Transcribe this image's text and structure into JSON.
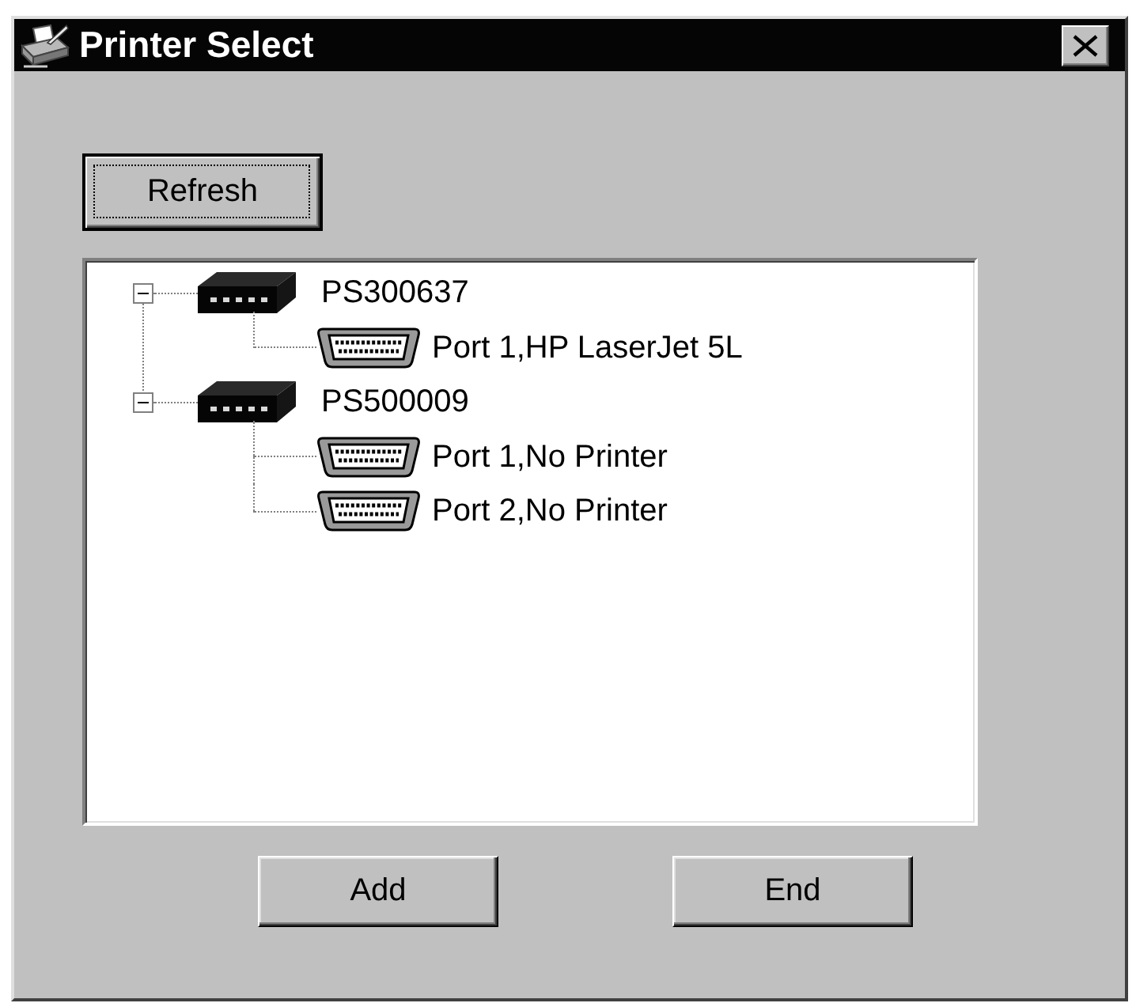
{
  "window": {
    "title": "Printer Select"
  },
  "refresh_button": {
    "label": "Refresh",
    "focused": true
  },
  "tree": [
    {
      "label": "PS300637",
      "kind": "server",
      "expanded": true,
      "children": [
        {
          "label": "Port 1,HP LaserJet 5L",
          "kind": "port"
        }
      ]
    },
    {
      "label": "PS500009",
      "kind": "server",
      "expanded": true,
      "children": [
        {
          "label": "Port 1,No Printer",
          "kind": "port"
        },
        {
          "label": "Port 2,No Printer",
          "kind": "port"
        }
      ]
    }
  ],
  "buttons": [
    {
      "label": "Add",
      "focused": false
    },
    {
      "label": "End",
      "focused": false
    }
  ]
}
